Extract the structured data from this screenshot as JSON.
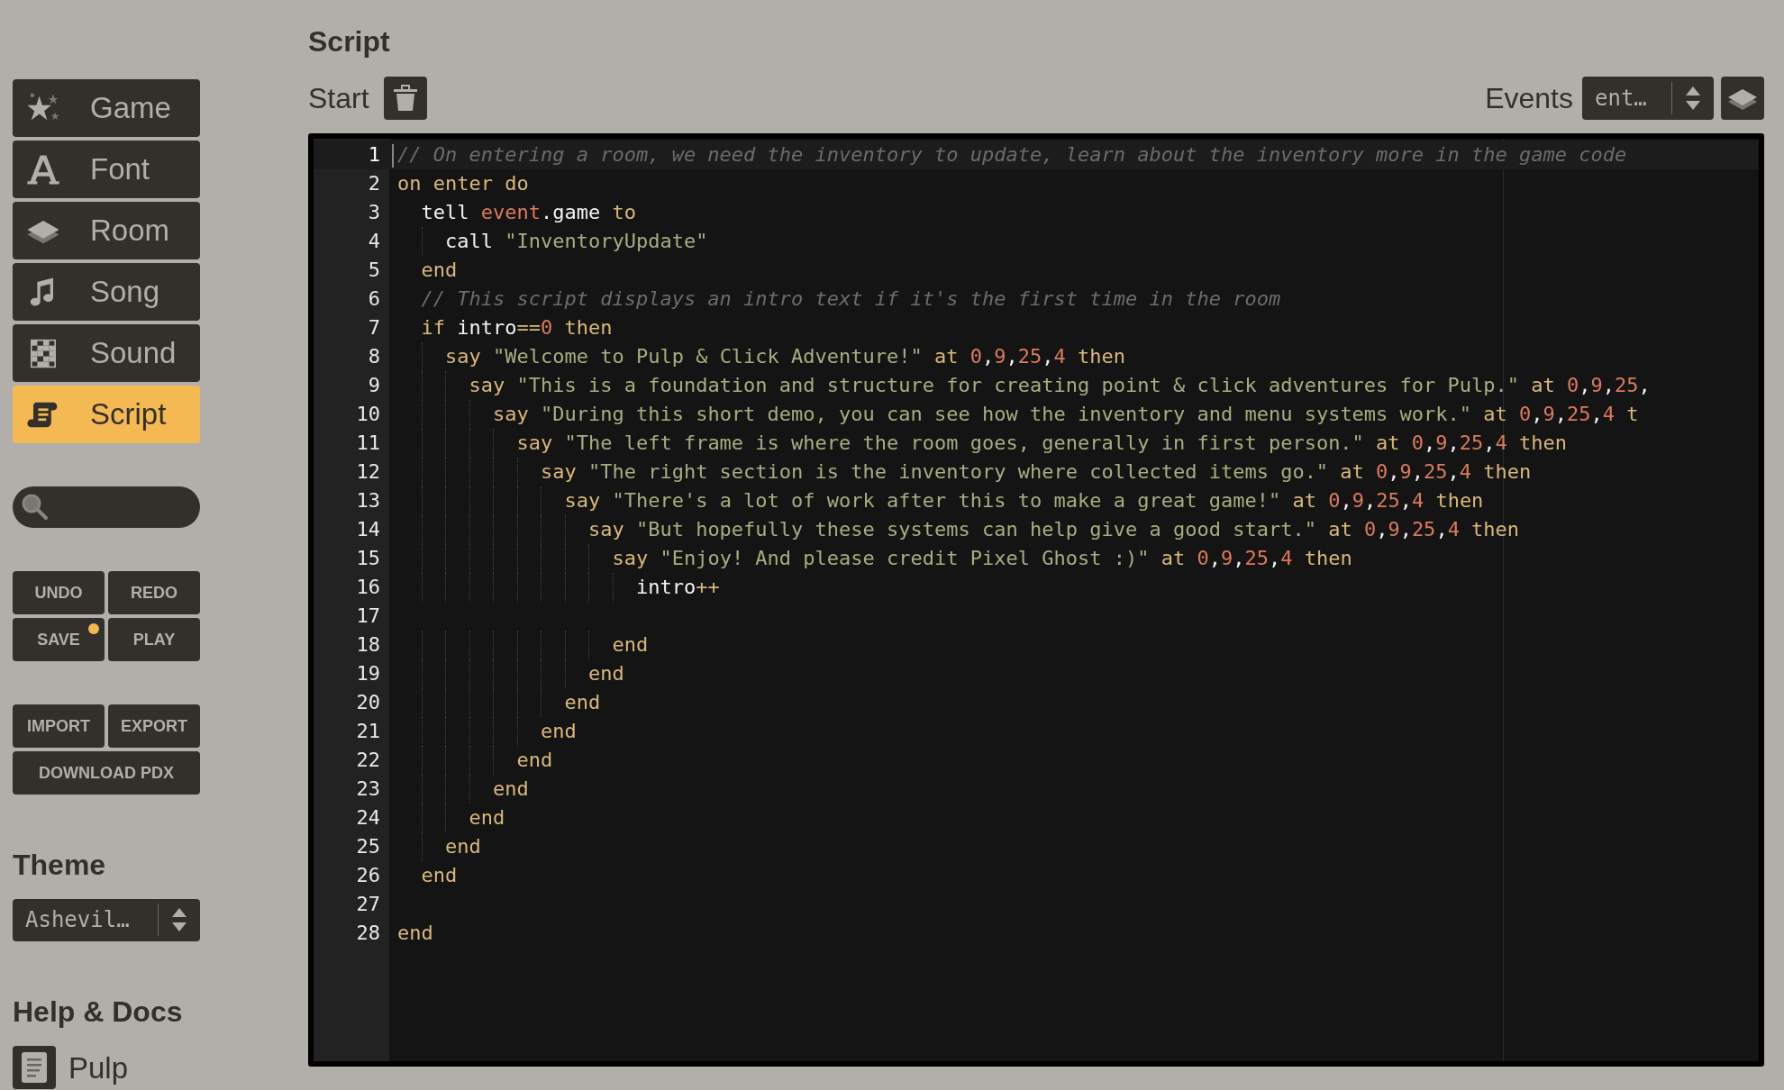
{
  "sidebar": {
    "nav": [
      {
        "label": "Game",
        "selected": false
      },
      {
        "label": "Font",
        "selected": false
      },
      {
        "label": "Room",
        "selected": false
      },
      {
        "label": "Song",
        "selected": false
      },
      {
        "label": "Sound",
        "selected": false
      },
      {
        "label": "Script",
        "selected": true
      }
    ],
    "actions": [
      {
        "label": "UNDO",
        "unsaved": false
      },
      {
        "label": "REDO",
        "unsaved": false
      },
      {
        "label": "SAVE",
        "unsaved": true
      },
      {
        "label": "PLAY",
        "unsaved": false
      }
    ],
    "transfer": [
      "IMPORT",
      "EXPORT"
    ],
    "download": "DOWNLOAD PDX",
    "theme": {
      "heading": "Theme",
      "value": "Ashevil…"
    },
    "help": {
      "heading": "Help & Docs",
      "items": [
        "Pulp"
      ]
    }
  },
  "main": {
    "title": "Script",
    "target": "Start",
    "events_label": "Events",
    "events_value": "ent…",
    "editor": {
      "lines": [
        {
          "number": "1",
          "active": true,
          "tokens": [
            {
              "kind": "comment",
              "text": "// On entering a room, we need the inventory to update, learn about the inventory more in the game code"
            }
          ]
        },
        {
          "number": "2",
          "active": false,
          "tokens": [
            {
              "kind": "keyword",
              "text": "on enter do"
            }
          ]
        },
        {
          "number": "3",
          "active": false,
          "tokens": [
            {
              "kind": "name",
              "text": "  tell "
            },
            {
              "kind": "variable",
              "text": "event"
            },
            {
              "kind": "name",
              "text": ".game "
            },
            {
              "kind": "keyword",
              "text": "to"
            }
          ]
        },
        {
          "number": "4",
          "active": false,
          "tokens": [
            {
              "kind": "name",
              "text": "    call "
            },
            {
              "kind": "string",
              "text": "\"InventoryUpdate\""
            }
          ]
        },
        {
          "number": "5",
          "active": false,
          "tokens": [
            {
              "kind": "keyword",
              "text": "  end"
            }
          ]
        },
        {
          "number": "6",
          "active": false,
          "tokens": [
            {
              "kind": "comment",
              "text": "  // This script displays an intro text if it's the first time in the room"
            }
          ]
        },
        {
          "number": "7",
          "active": false,
          "tokens": [
            {
              "kind": "keyword",
              "text": "  if "
            },
            {
              "kind": "name",
              "text": "intro"
            },
            {
              "kind": "keyword",
              "text": "=="
            },
            {
              "kind": "number",
              "text": "0"
            },
            {
              "kind": "keyword",
              "text": " then"
            }
          ]
        },
        {
          "number": "8",
          "active": false,
          "tokens": [
            {
              "kind": "keyword",
              "text": "    say "
            },
            {
              "kind": "string",
              "text": "\"Welcome to Pulp & Click Adventure!\""
            },
            {
              "kind": "keyword",
              "text": " at "
            },
            {
              "kind": "number",
              "text": "0"
            },
            {
              "kind": "name",
              "text": ","
            },
            {
              "kind": "number",
              "text": "9"
            },
            {
              "kind": "name",
              "text": ","
            },
            {
              "kind": "number",
              "text": "25"
            },
            {
              "kind": "name",
              "text": ","
            },
            {
              "kind": "number",
              "text": "4"
            },
            {
              "kind": "keyword",
              "text": " then"
            }
          ]
        },
        {
          "number": "9",
          "active": false,
          "tokens": [
            {
              "kind": "keyword",
              "text": "      say "
            },
            {
              "kind": "string",
              "text": "\"This is a foundation and structure for creating point & click adventures for Pulp.\""
            },
            {
              "kind": "keyword",
              "text": " at "
            },
            {
              "kind": "number",
              "text": "0"
            },
            {
              "kind": "name",
              "text": ","
            },
            {
              "kind": "number",
              "text": "9"
            },
            {
              "kind": "name",
              "text": ","
            },
            {
              "kind": "number",
              "text": "25"
            },
            {
              "kind": "name",
              "text": ","
            }
          ]
        },
        {
          "number": "10",
          "active": false,
          "tokens": [
            {
              "kind": "keyword",
              "text": "        say "
            },
            {
              "kind": "string",
              "text": "\"During this short demo, you can see how the inventory and menu systems work.\""
            },
            {
              "kind": "keyword",
              "text": " at "
            },
            {
              "kind": "number",
              "text": "0"
            },
            {
              "kind": "name",
              "text": ","
            },
            {
              "kind": "number",
              "text": "9"
            },
            {
              "kind": "name",
              "text": ","
            },
            {
              "kind": "number",
              "text": "25"
            },
            {
              "kind": "name",
              "text": ","
            },
            {
              "kind": "number",
              "text": "4"
            },
            {
              "kind": "keyword",
              "text": " t"
            }
          ]
        },
        {
          "number": "11",
          "active": false,
          "tokens": [
            {
              "kind": "keyword",
              "text": "          say "
            },
            {
              "kind": "string",
              "text": "\"The left frame is where the room goes, generally in first person.\""
            },
            {
              "kind": "keyword",
              "text": " at "
            },
            {
              "kind": "number",
              "text": "0"
            },
            {
              "kind": "name",
              "text": ","
            },
            {
              "kind": "number",
              "text": "9"
            },
            {
              "kind": "name",
              "text": ","
            },
            {
              "kind": "number",
              "text": "25"
            },
            {
              "kind": "name",
              "text": ","
            },
            {
              "kind": "number",
              "text": "4"
            },
            {
              "kind": "keyword",
              "text": " then"
            }
          ]
        },
        {
          "number": "12",
          "active": false,
          "tokens": [
            {
              "kind": "keyword",
              "text": "            say "
            },
            {
              "kind": "string",
              "text": "\"The right section is the inventory where collected items go.\""
            },
            {
              "kind": "keyword",
              "text": " at "
            },
            {
              "kind": "number",
              "text": "0"
            },
            {
              "kind": "name",
              "text": ","
            },
            {
              "kind": "number",
              "text": "9"
            },
            {
              "kind": "name",
              "text": ","
            },
            {
              "kind": "number",
              "text": "25"
            },
            {
              "kind": "name",
              "text": ","
            },
            {
              "kind": "number",
              "text": "4"
            },
            {
              "kind": "keyword",
              "text": " then"
            }
          ]
        },
        {
          "number": "13",
          "active": false,
          "tokens": [
            {
              "kind": "keyword",
              "text": "              say "
            },
            {
              "kind": "string",
              "text": "\"There's a lot of work after this to make a great game!\""
            },
            {
              "kind": "keyword",
              "text": " at "
            },
            {
              "kind": "number",
              "text": "0"
            },
            {
              "kind": "name",
              "text": ","
            },
            {
              "kind": "number",
              "text": "9"
            },
            {
              "kind": "name",
              "text": ","
            },
            {
              "kind": "number",
              "text": "25"
            },
            {
              "kind": "name",
              "text": ","
            },
            {
              "kind": "number",
              "text": "4"
            },
            {
              "kind": "keyword",
              "text": " then"
            }
          ]
        },
        {
          "number": "14",
          "active": false,
          "tokens": [
            {
              "kind": "keyword",
              "text": "                say "
            },
            {
              "kind": "string",
              "text": "\"But hopefully these systems can help give a good start.\""
            },
            {
              "kind": "keyword",
              "text": " at "
            },
            {
              "kind": "number",
              "text": "0"
            },
            {
              "kind": "name",
              "text": ","
            },
            {
              "kind": "number",
              "text": "9"
            },
            {
              "kind": "name",
              "text": ","
            },
            {
              "kind": "number",
              "text": "25"
            },
            {
              "kind": "name",
              "text": ","
            },
            {
              "kind": "number",
              "text": "4"
            },
            {
              "kind": "keyword",
              "text": " then"
            }
          ]
        },
        {
          "number": "15",
          "active": false,
          "tokens": [
            {
              "kind": "keyword",
              "text": "                  say "
            },
            {
              "kind": "string",
              "text": "\"Enjoy! And please credit Pixel Ghost :)\""
            },
            {
              "kind": "keyword",
              "text": " at "
            },
            {
              "kind": "number",
              "text": "0"
            },
            {
              "kind": "name",
              "text": ","
            },
            {
              "kind": "number",
              "text": "9"
            },
            {
              "kind": "name",
              "text": ","
            },
            {
              "kind": "number",
              "text": "25"
            },
            {
              "kind": "name",
              "text": ","
            },
            {
              "kind": "number",
              "text": "4"
            },
            {
              "kind": "keyword",
              "text": " then"
            }
          ]
        },
        {
          "number": "16",
          "active": false,
          "tokens": [
            {
              "kind": "name",
              "text": "                    intro"
            },
            {
              "kind": "keyword",
              "text": "++"
            }
          ]
        },
        {
          "number": "17",
          "active": false
        },
        {
          "number": "18",
          "active": false,
          "tokens": [
            {
              "kind": "keyword",
              "text": "                  end"
            }
          ]
        },
        {
          "number": "19",
          "active": false,
          "tokens": [
            {
              "kind": "keyword",
              "text": "                end"
            }
          ]
        },
        {
          "number": "20",
          "active": false,
          "tokens": [
            {
              "kind": "keyword",
              "text": "              end"
            }
          ]
        },
        {
          "number": "21",
          "active": false,
          "tokens": [
            {
              "kind": "keyword",
              "text": "            end"
            }
          ]
        },
        {
          "number": "22",
          "active": false,
          "tokens": [
            {
              "kind": "keyword",
              "text": "          end"
            }
          ]
        },
        {
          "number": "23",
          "active": false,
          "tokens": [
            {
              "kind": "keyword",
              "text": "        end"
            }
          ]
        },
        {
          "number": "24",
          "active": false,
          "tokens": [
            {
              "kind": "keyword",
              "text": "      end"
            }
          ]
        },
        {
          "number": "25",
          "active": false,
          "tokens": [
            {
              "kind": "keyword",
              "text": "    end"
            }
          ]
        },
        {
          "number": "26",
          "active": false,
          "tokens": [
            {
              "kind": "keyword",
              "text": "  end"
            }
          ]
        },
        {
          "number": "27",
          "active": false
        },
        {
          "number": "28",
          "active": false,
          "tokens": [
            {
              "kind": "keyword",
              "text": "end"
            }
          ]
        }
      ]
    }
  }
}
